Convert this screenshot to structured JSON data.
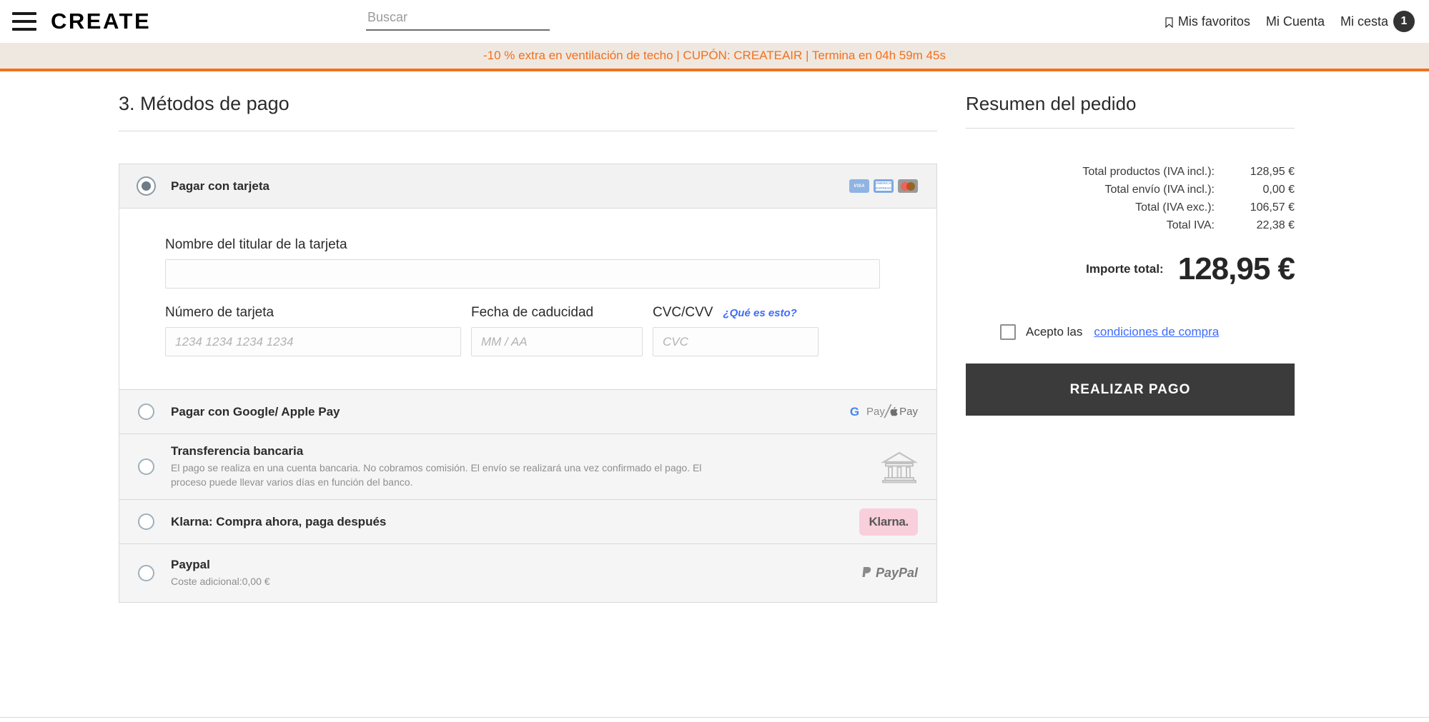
{
  "header": {
    "brand": "CREATE",
    "menu_icon": "hamburger-icon",
    "search_placeholder": "Buscar",
    "search_value": "",
    "favorites_label": "Mis favoritos",
    "account_label": "Mi Cuenta",
    "cart_label": "Mi cesta",
    "cart_count": "1"
  },
  "promo": {
    "text": "-10 % extra en ventilación de techo | CUPÓN: CREATEAIR | Termina en 04h 59m 45s",
    "text_color": "#f2701d",
    "background": "#efe8e0",
    "border_color": "#f0721e"
  },
  "main": {
    "section_title": "3. Métodos de pago",
    "methods": [
      {
        "id": "card",
        "label": "Pagar con tarjeta",
        "selected": true,
        "logos": [
          "visa-logo",
          "amex-logo",
          "mastercard-logo"
        ],
        "visa_text": "VISA",
        "amex_text": "AMERICAN EXPRESS"
      },
      {
        "id": "googleapple",
        "label": "Pagar con Google/ Apple Pay",
        "selected": false,
        "gpay_g": "G",
        "gpay_text": "Pay",
        "applepay_text": "Pay"
      },
      {
        "id": "transfer",
        "label": "Transferencia bancaria",
        "selected": false,
        "description": "El pago se realiza en una cuenta bancaria. No cobramos comisión. El envío se realizará una vez confirmado el pago. El proceso puede llevar varios días en función del banco.",
        "logo": "bank-icon"
      },
      {
        "id": "klarna",
        "label": "Klarna: Compra ahora, paga después",
        "selected": false,
        "logo_text": "Klarna.",
        "logo_bg": "#f9cfdc"
      },
      {
        "id": "paypal",
        "label": "Paypal",
        "selected": false,
        "description": "Coste adicional:0,00 €",
        "logo_text": "PayPal"
      }
    ],
    "card_form": {
      "holder_label": "Nombre del titular de la tarjeta",
      "holder_value": "",
      "holder_placeholder": "",
      "number_label": "Número de tarjeta",
      "number_placeholder": "1234 1234 1234 1234",
      "number_value": "",
      "expiry_label": "Fecha de caducidad",
      "expiry_placeholder": "MM / AA",
      "expiry_value": "",
      "cvc_label": "CVC/CVV",
      "cvc_placeholder": "CVC",
      "cvc_value": "",
      "cvc_help": "¿Qué es esto?"
    }
  },
  "summary": {
    "title": "Resumen del pedido",
    "lines": [
      {
        "label": "Total productos (IVA incl.):",
        "value": "128,95 €"
      },
      {
        "label": "Total envío (IVA incl.):",
        "value": "0,00 €"
      },
      {
        "label": "Total (IVA exc.):",
        "value": "106,57 €"
      },
      {
        "label": "Total IVA:",
        "value": "22,38 €"
      }
    ],
    "total_label": "Importe total:",
    "total_value": "128,95 €",
    "terms_text": "Acepto las",
    "terms_link": "condiciones de compra",
    "terms_checked": false,
    "pay_button": "REALIZAR PAGO",
    "pay_button_color": "#3b3b3b"
  }
}
